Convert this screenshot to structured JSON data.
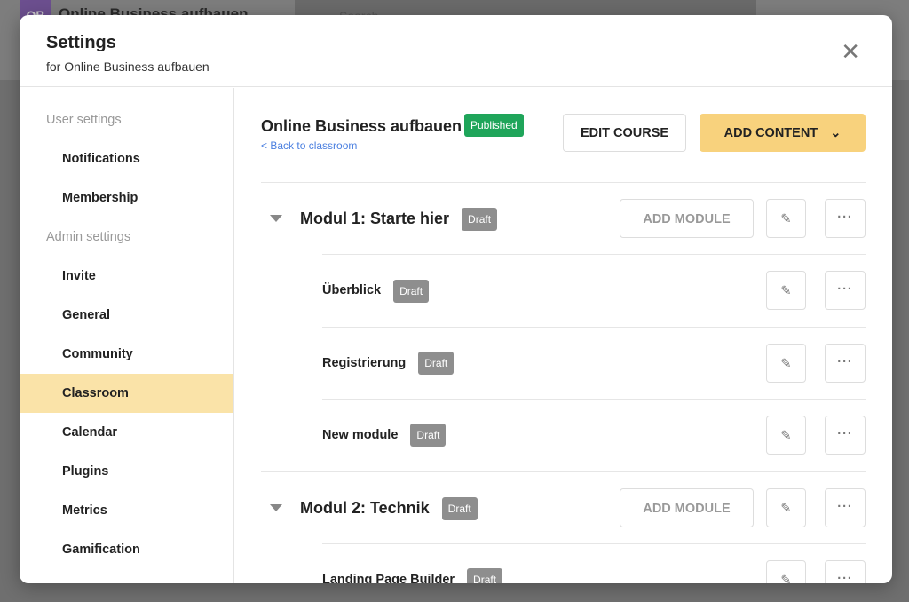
{
  "appbar": {
    "avatar": "OB",
    "title": "Online Business aufbauen",
    "search_placeholder": "Search"
  },
  "modal": {
    "title": "Settings",
    "subtitle": "for Online Business aufbauen"
  },
  "sidebar": [
    {
      "label": "User settings",
      "type": "header"
    },
    {
      "label": "Notifications"
    },
    {
      "label": "Membership"
    },
    {
      "label": "Admin settings",
      "type": "header"
    },
    {
      "label": "Invite"
    },
    {
      "label": "General"
    },
    {
      "label": "Community"
    },
    {
      "label": "Classroom",
      "active": true
    },
    {
      "label": "Calendar"
    },
    {
      "label": "Plugins"
    },
    {
      "label": "Metrics"
    },
    {
      "label": "Gamification"
    }
  ],
  "course": {
    "title": "Online Business aufbauen",
    "status": "Published",
    "back": "< Back to classroom",
    "edit": "EDIT COURSE",
    "add": "ADD CONTENT"
  },
  "rows": [
    {
      "type": "module",
      "title": "Modul 1: Starte hier",
      "status": "Draft"
    },
    {
      "type": "lesson",
      "title": "Überblick",
      "status": "Draft"
    },
    {
      "type": "lesson",
      "title": "Registrierung",
      "status": "Draft"
    },
    {
      "type": "lesson",
      "title": "New module",
      "status": "Draft"
    },
    {
      "type": "module",
      "title": "Modul 2: Technik",
      "status": "Draft"
    },
    {
      "type": "lesson",
      "title": "Landing Page Builder",
      "status": "Draft"
    }
  ],
  "labels": {
    "add_module": "ADD MODULE"
  },
  "colors": {
    "accent": "#f8d27d",
    "published": "#1fa55a",
    "draft": "#8e8e8e",
    "active_nav": "#fae3a8"
  }
}
